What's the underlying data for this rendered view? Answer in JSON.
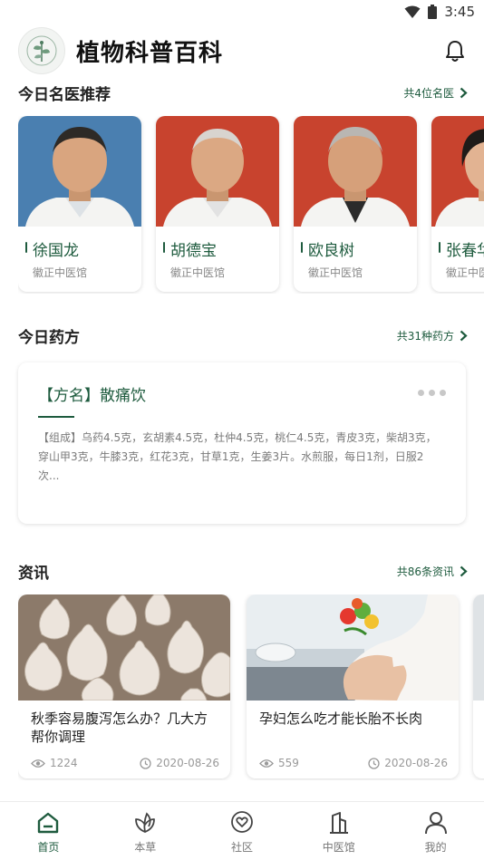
{
  "status_bar": {
    "time": "3:45"
  },
  "header": {
    "title": "植物科普百科",
    "logo_icon": "herb-leaf-logo",
    "bell_icon": "bell-icon"
  },
  "doctors_section": {
    "title": "今日名医推荐",
    "more_label": "共4位名医",
    "items": [
      {
        "name": "徐国龙",
        "clinic": "徽正中医馆",
        "photo_bg": "#4a7fb0"
      },
      {
        "name": "胡德宝",
        "clinic": "徽正中医馆",
        "photo_bg": "#c8432e"
      },
      {
        "name": "欧良树",
        "clinic": "徽正中医馆",
        "photo_bg": "#c8432e"
      },
      {
        "name": "张春华",
        "clinic": "徽正中医馆",
        "photo_bg": "#c8432e"
      }
    ]
  },
  "recipe_section": {
    "title": "今日药方",
    "more_label": "共31种药方",
    "card": {
      "name": "【方名】散痛饮",
      "composition": "【组成】乌药4.5克，玄胡素4.5克，杜仲4.5克，桃仁4.5克，青皮3克，柴胡3克，穿山甲3克，牛膝3克，红花3克，甘草1克，生姜3片。水煎服，每日1剂，日服2次..."
    }
  },
  "news_section": {
    "title": "资讯",
    "more_label": "共86条资讯",
    "items": [
      {
        "title": "秋季容易腹泻怎么办？几大方帮你调理",
        "views": "1224",
        "date": "2020-08-26"
      },
      {
        "title": "孕妇怎么吃才能长胎不长肉",
        "views": "559",
        "date": "2020-08-26"
      }
    ]
  },
  "tabbar": {
    "items": [
      {
        "label": "首页",
        "icon": "home-icon",
        "active": true
      },
      {
        "label": "本草",
        "icon": "leaf-icon",
        "active": false
      },
      {
        "label": "社区",
        "icon": "heart-chat-icon",
        "active": false
      },
      {
        "label": "中医馆",
        "icon": "building-icon",
        "active": false
      },
      {
        "label": "我的",
        "icon": "user-icon",
        "active": false
      }
    ]
  },
  "colors": {
    "accent": "#1e5b3e",
    "muted": "#888888"
  }
}
